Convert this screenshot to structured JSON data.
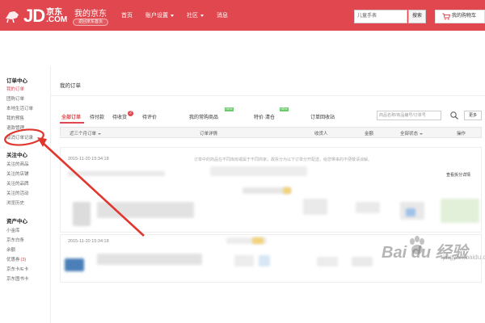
{
  "header": {
    "logo_jd": "JD",
    "logo_cn": "京东",
    "logo_com": ".COM",
    "my_jd": "我的京东",
    "home_pill": "返回京东首页",
    "nav": [
      {
        "label": "首页",
        "has_caret": false
      },
      {
        "label": "账户设置",
        "has_caret": true
      },
      {
        "label": "社区",
        "has_caret": true
      },
      {
        "label": "消息",
        "has_caret": false
      }
    ],
    "search_value": "儿童手表",
    "search_button": "搜索",
    "cart_label": "我的购物车",
    "brand_color": "#e0474f"
  },
  "sidebar": {
    "groups": [
      {
        "title": "订单中心",
        "items": [
          "我的订单",
          "团购订单",
          "本地生活订单",
          "我的预售",
          "退款管理",
          "取消订单记录"
        ]
      },
      {
        "title": "关注中心",
        "items": [
          "关注的商品",
          "关注的店铺",
          "关注的品牌",
          "关注的活动",
          "浏览历史"
        ]
      },
      {
        "title": "资产中心",
        "items": [
          "小金库",
          "京东白条",
          "余额",
          "优惠券",
          "京东卡/E卡",
          "京东图书卡"
        ]
      }
    ],
    "coupon_badge": "(3)"
  },
  "main": {
    "page_title": "我的订单",
    "tabs": [
      {
        "label": "全部订单",
        "active": true
      },
      {
        "label": "待付款",
        "active": false
      },
      {
        "label": "待收货",
        "active": false
      },
      {
        "label": "待评价",
        "active": false
      },
      {
        "label": "我的常购商品",
        "active": false
      },
      {
        "label": "特价·清仓",
        "active": false
      },
      {
        "label": "订单回收站",
        "active": false
      }
    ],
    "tab_badge": "2",
    "new_tag": "NEW",
    "order_search_placeholder": "商品名称/商品编号/订单号",
    "more_button": "更多",
    "table_headers": [
      {
        "label": "近三个月订单",
        "has_caret": true
      },
      {
        "label": "订单详情",
        "has_caret": false
      },
      {
        "label": "收货人",
        "has_caret": false
      },
      {
        "label": "金额",
        "has_caret": false
      },
      {
        "label": "全部状态",
        "has_caret": true
      },
      {
        "label": "操作",
        "has_caret": false
      }
    ],
    "order_dates": [
      "2015-11-20 15:34:18",
      "2015-11-20 15:34:18"
    ],
    "notice_text": "订单中的商品在不同库房或属于不同商家，故拆分为以下订单分开配送，给您带来的不便敬请谅解。",
    "split_link": "查看拆分详情"
  },
  "watermark": {
    "text": "Bai du 经验",
    "sub": "jingyan.baidu.com"
  }
}
